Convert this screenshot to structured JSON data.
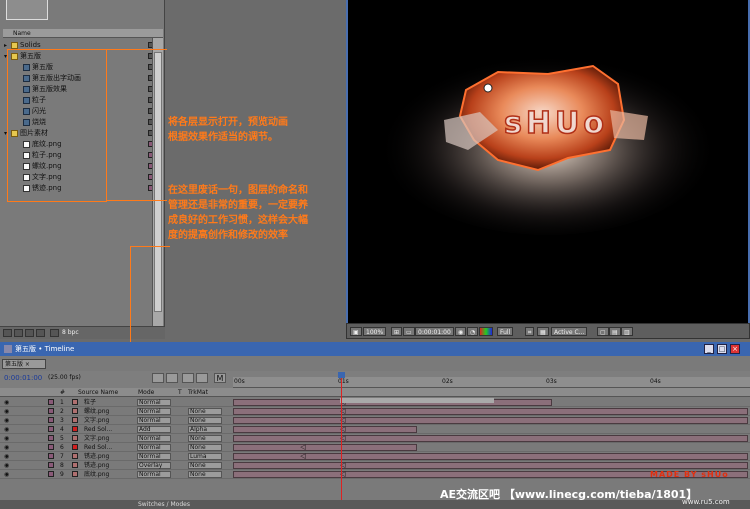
{
  "project": {
    "column_name": "Name",
    "items": [
      {
        "label": "Solids",
        "type": "folder",
        "indent": 0,
        "arrow": "▸",
        "label_color": "#555555"
      },
      {
        "label": "第五版",
        "type": "folder",
        "indent": 0,
        "arrow": "▾",
        "label_color": "#555555"
      },
      {
        "label": "第五版",
        "type": "comp",
        "indent": 1,
        "arrow": "",
        "label_color": "#555555"
      },
      {
        "label": "第五版出字动画",
        "type": "comp",
        "indent": 1,
        "arrow": "",
        "label_color": "#555555"
      },
      {
        "label": "第五版效果",
        "type": "comp",
        "indent": 1,
        "arrow": "",
        "label_color": "#555555"
      },
      {
        "label": "粒子",
        "type": "comp",
        "indent": 1,
        "arrow": "",
        "label_color": "#555555"
      },
      {
        "label": "闪光",
        "type": "comp",
        "indent": 1,
        "arrow": "",
        "label_color": "#555555"
      },
      {
        "label": "烧烧",
        "type": "comp",
        "indent": 1,
        "arrow": "",
        "label_color": "#555555"
      },
      {
        "label": "图片素材",
        "type": "folder",
        "indent": 0,
        "arrow": "▾",
        "label_color": "#555555"
      },
      {
        "label": "底纹.png",
        "type": "img",
        "indent": 1,
        "arrow": "",
        "label_color": "#8a5a78"
      },
      {
        "label": "粒子.png",
        "type": "img",
        "indent": 1,
        "arrow": "",
        "label_color": "#8a5a78"
      },
      {
        "label": "螺纹.png",
        "type": "img",
        "indent": 1,
        "arrow": "",
        "label_color": "#8a5a78"
      },
      {
        "label": "文字.png",
        "type": "img",
        "indent": 1,
        "arrow": "",
        "label_color": "#8a5a78"
      },
      {
        "label": "锈迹.png",
        "type": "img",
        "indent": 1,
        "arrow": "",
        "label_color": "#8a5a78"
      }
    ],
    "bpc": "8 bpc"
  },
  "viewer": {
    "logo_text": "sHUo",
    "zoom": "100%",
    "timecode": "0:00:01:00",
    "resolution": "Full",
    "camera": "Active C..."
  },
  "annotations": {
    "note1_line1": "将各层显示打开，预览动画",
    "note1_line2": "根据效果作适当的调节。",
    "note2_line1": "在这里废话一句，图层的命名和",
    "note2_line2": "管理还是非常的重要，一定要养",
    "note2_line3": "成良好的工作习惯，这样会大幅",
    "note2_line4": "度的提高创作和修改的效率",
    "accent": "#ff7a1a"
  },
  "timeline": {
    "window_title": "第五版 • Timeline",
    "tab_label": "第五版",
    "time": "0:00:01:00",
    "fps": "(25.00 fps)",
    "headers": {
      "num": "#",
      "source": "Source Name",
      "mode": "Mode",
      "t": "T",
      "trkmat": "TrkMat"
    },
    "ruler": [
      "00s",
      "01s",
      "02s",
      "03s",
      "04s"
    ],
    "switches_label": "Switches / Modes",
    "layers": [
      {
        "num": "1",
        "name": "粒子",
        "color": "#b07070",
        "mode": "Normal",
        "trkmat": "",
        "start": 0.0,
        "end": 0.62,
        "kf_at": 1.0
      },
      {
        "num": "2",
        "name": "螺纹.png",
        "color": "#b07070",
        "mode": "Normal",
        "trkmat": "None",
        "start": 0.0,
        "end": 1.0,
        "kf_at": 1.0
      },
      {
        "num": "3",
        "name": "文字.png",
        "color": "#b07070",
        "mode": "Normal",
        "trkmat": "None",
        "start": 0.0,
        "end": 1.0,
        "kf_at": 1.0
      },
      {
        "num": "4",
        "name": "Red Sol...",
        "color": "#d02020",
        "mode": "Add",
        "trkmat": "Alpha",
        "start": 0.0,
        "end": 0.36,
        "kf_at": 1.0
      },
      {
        "num": "5",
        "name": "文字.png",
        "color": "#b07070",
        "mode": "Normal",
        "trkmat": "None",
        "start": 0.0,
        "end": 1.0,
        "kf_at": 1.0
      },
      {
        "num": "6",
        "name": "Red Sol...",
        "color": "#d02020",
        "mode": "Normal",
        "trkmat": "None",
        "start": 0.0,
        "end": 0.36,
        "kf_at": 0.13
      },
      {
        "num": "7",
        "name": "锈迹.png",
        "color": "#b07070",
        "mode": "Normal",
        "trkmat": "Luma",
        "start": 0.0,
        "end": 1.0,
        "kf_at": 0.13
      },
      {
        "num": "8",
        "name": "锈迹.png",
        "color": "#b07070",
        "mode": "Overlay",
        "trkmat": "None",
        "start": 0.0,
        "end": 1.0,
        "kf_at": 1.0
      },
      {
        "num": "9",
        "name": "底纹.png",
        "color": "#b07070",
        "mode": "Normal",
        "trkmat": "None",
        "start": 0.0,
        "end": 1.0,
        "kf_at": 1.0
      }
    ]
  },
  "watermark": {
    "text": "AE交流区吧 【www.linecg.com/tieba/1801】",
    "made_by": "MADE BY sHUo",
    "site": "www.ru5.com"
  }
}
